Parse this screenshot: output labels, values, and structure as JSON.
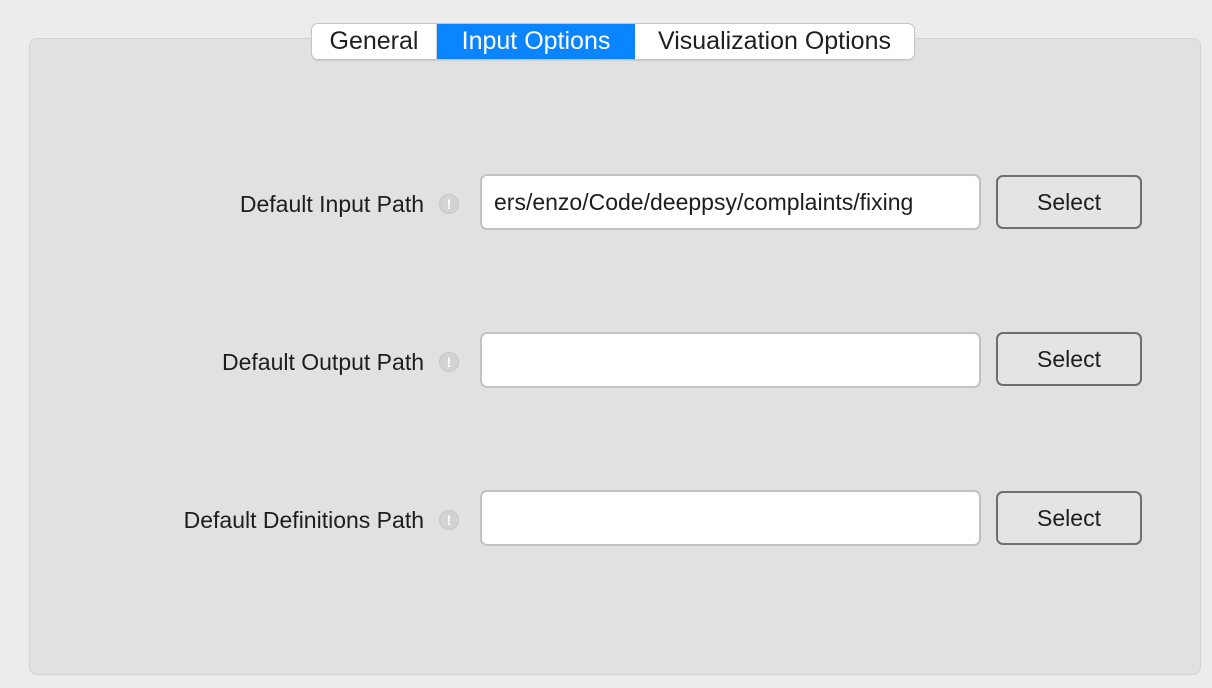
{
  "tabs": {
    "general": "General",
    "input_options": "Input Options",
    "visualization_options": "Visualization Options",
    "selected": "Input Options"
  },
  "fields": [
    {
      "label": "Default Input Path",
      "info_icon": "exclamation-circle-icon",
      "value": "ers/enzo/Code/deeppsy/complaints/fixing",
      "button_label": "Select"
    },
    {
      "label": "Default Output Path",
      "info_icon": "exclamation-circle-icon",
      "value": "",
      "button_label": "Select"
    },
    {
      "label": "Default Definitions Path",
      "info_icon": "exclamation-circle-icon",
      "value": "",
      "button_label": "Select"
    }
  ],
  "colors": {
    "accent": "#0b84ff",
    "panel_background": "#e1e1e1",
    "window_background": "#ececec"
  }
}
